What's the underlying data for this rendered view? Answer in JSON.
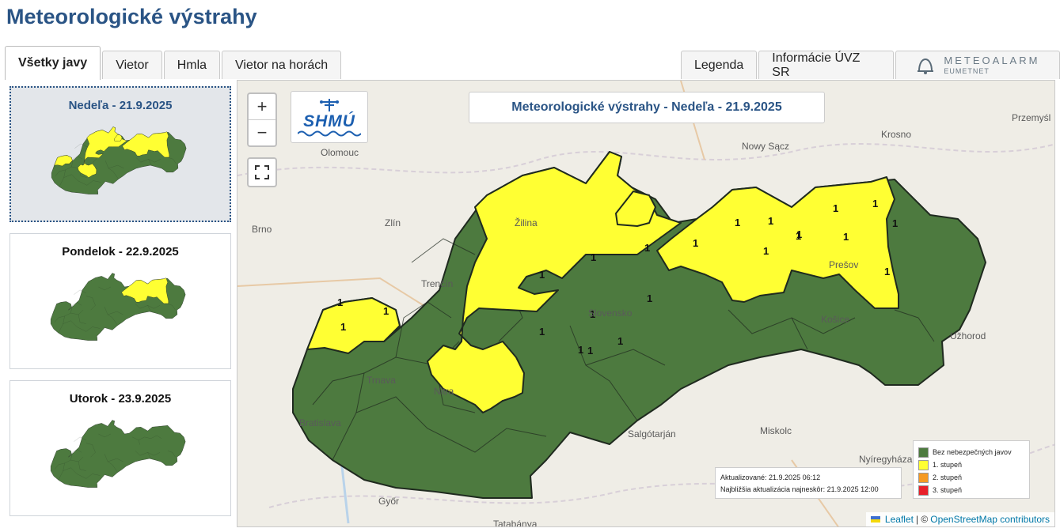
{
  "page": {
    "title": "Meteorologické výstrahy"
  },
  "tabs_left": [
    "Všetky javy",
    "Vietor",
    "Hmla",
    "Vietor na horách"
  ],
  "tabs_right": [
    "Legenda",
    "Informácie ÚVZ SR"
  ],
  "meteoalarm": {
    "title": "METEOALARM",
    "subtitle": "EUMETNET"
  },
  "days": [
    {
      "label": "Nedeľa - 21.9.2025",
      "selected": true
    },
    {
      "label": "Pondelok - 22.9.2025",
      "selected": false
    },
    {
      "label": "Utorok - 23.9.2025",
      "selected": false
    }
  ],
  "map": {
    "title": "Meteorologické výstrahy - Nedeľa - 21.9.2025",
    "zoom_in": "+",
    "zoom_out": "−",
    "logo": "SHMÚ",
    "warning_level": "1",
    "cities": [
      "Olomouc",
      "Krosno",
      "Przemyśl",
      "Nowy Sącz",
      "Zlín",
      "Brno",
      "Žilina",
      "Trenčín",
      "Slovensko",
      "Prešov",
      "Košice",
      "Užhorod",
      "Trnava",
      "Nitra",
      "Bratislava",
      "Salgótarján",
      "Miskolc",
      "Nyíregyháza",
      "Győr",
      "Tatabánya"
    ],
    "updated_line": "Aktualizované: 21.9.2025 06:12",
    "next_update_line": "Najbližšia aktualizácia najneskôr: 21.9.2025 12:00",
    "legend": [
      {
        "label": "Bez nebezpečných javov",
        "color": "#4d7a3f"
      },
      {
        "label": "1. stupeň",
        "color": "#ffff33"
      },
      {
        "label": "2. stupeň",
        "color": "#f59a23"
      },
      {
        "label": "3. stupeň",
        "color": "#e8202a"
      }
    ],
    "attribution": {
      "leaflet": "Leaflet",
      "sep": " | © ",
      "osm": "OpenStreetMap contributors"
    }
  },
  "colors": {
    "green": "#4d7a3f",
    "yellow": "#ffff33",
    "border": "#1f2a1f",
    "title_blue": "#2a5485"
  }
}
